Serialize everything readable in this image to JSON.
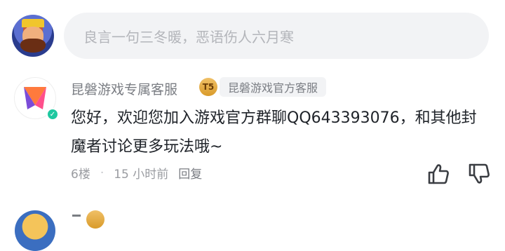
{
  "comment_input": {
    "placeholder": "良言一句三冬暖，恶语伤人六月寒"
  },
  "comment": {
    "author": "昆磐游戏专属客服",
    "level_badge": "T5",
    "tag": "昆磐游戏官方客服",
    "text": "您好，欢迎您加入游戏官方群聊QQ643393076，和其他封魔者讨论更多玩法哦~",
    "floor": "6楼",
    "separator": "·",
    "time": "15 小时前",
    "reply_label": "回复"
  },
  "icons": {
    "like": "thumbs-up-icon",
    "dislike": "thumbs-down-icon",
    "verified": "verified-check-icon"
  }
}
